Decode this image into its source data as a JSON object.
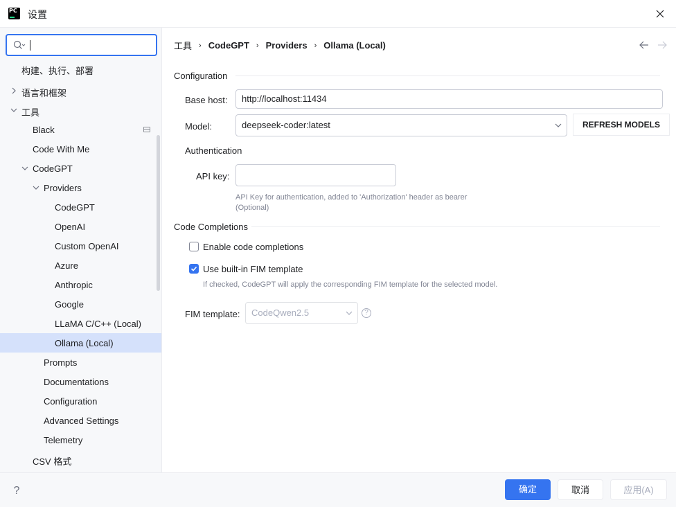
{
  "window": {
    "title": "设置",
    "logo_text": "PC"
  },
  "search": {
    "value": "",
    "placeholder": ""
  },
  "tree": [
    {
      "label": "构建、执行、部署"
    },
    {
      "label": "语言和框架"
    },
    {
      "label": "工具"
    },
    {
      "label": "Black"
    },
    {
      "label": "Code With Me"
    },
    {
      "label": "CodeGPT"
    },
    {
      "label": "Providers"
    },
    {
      "label": "CodeGPT"
    },
    {
      "label": "OpenAI"
    },
    {
      "label": "Custom OpenAI"
    },
    {
      "label": "Azure"
    },
    {
      "label": "Anthropic"
    },
    {
      "label": "Google"
    },
    {
      "label": "LLaMA C/C++ (Local)"
    },
    {
      "label": "Ollama (Local)"
    },
    {
      "label": "Prompts"
    },
    {
      "label": "Documentations"
    },
    {
      "label": "Configuration"
    },
    {
      "label": "Advanced Settings"
    },
    {
      "label": "Telemetry"
    },
    {
      "label": "CSV 格式"
    }
  ],
  "breadcrumb": [
    "工具",
    "CodeGPT",
    "Providers",
    "Ollama (Local)"
  ],
  "breadcrumb_sep": "›",
  "config": {
    "section_title": "Configuration",
    "base_host_label": "Base host:",
    "base_host_value": "http://localhost:11434",
    "model_label": "Model:",
    "model_value": "deepseek-coder:latest",
    "refresh_label": "REFRESH MODELS",
    "auth_title": "Authentication",
    "api_key_label": "API key:",
    "api_key_value": "",
    "api_key_hint_1": "API Key for authentication, added to 'Authorization' header as bearer",
    "api_key_hint_2": "(Optional)"
  },
  "completions": {
    "section_title": "Code Completions",
    "enable_label": "Enable code completions",
    "enable_checked": false,
    "fim_builtin_label": "Use built-in FIM template",
    "fim_builtin_checked": true,
    "fim_hint": "If checked, CodeGPT will apply the corresponding FIM template for the selected model.",
    "fim_template_label": "FIM template:",
    "fim_template_value": "CodeQwen2.5",
    "help_glyph": "?"
  },
  "footer": {
    "help": "?",
    "ok": "确定",
    "cancel": "取消",
    "apply": "应用(A)"
  },
  "colors": {
    "accent": "#3574f0",
    "selected_row": "#d5e1fb",
    "sidebar_bg": "#f7f8fa"
  }
}
